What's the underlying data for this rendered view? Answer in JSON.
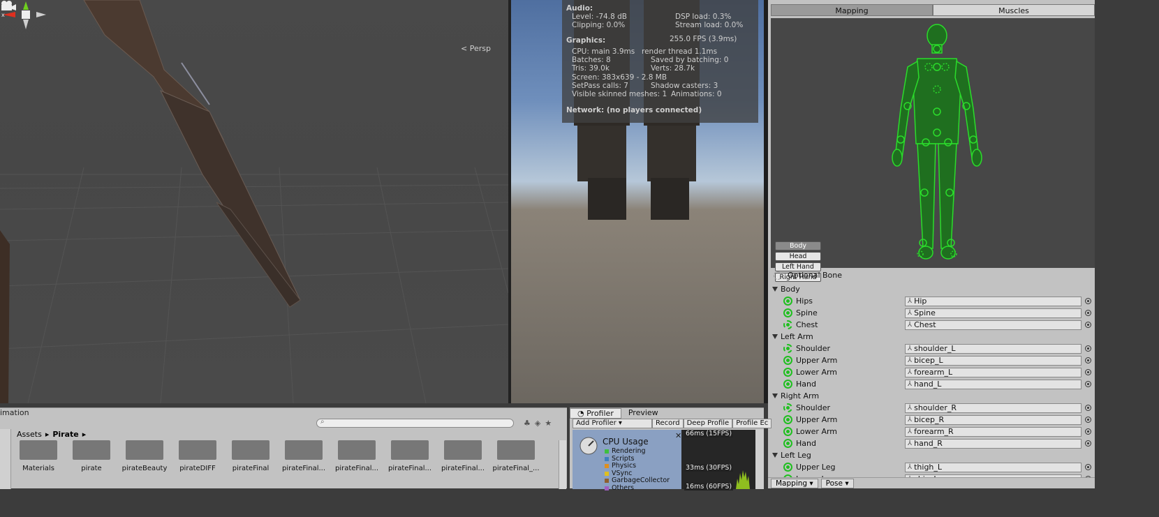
{
  "scene": {
    "persp_label": "Persp"
  },
  "stats": {
    "audio_header": "Audio:",
    "audio_rows": [
      [
        "Level: -74.8 dB",
        "DSP load: 0.3%"
      ],
      [
        "Clipping: 0.0%",
        "Stream load: 0.0%"
      ]
    ],
    "graphics_header": "Graphics:",
    "fps": "255.0 FPS (3.9ms)",
    "graphics_rows": [
      [
        "CPU: main 3.9ms",
        "render thread 1.1ms"
      ],
      [
        "Batches: 8",
        "Saved by batching: 0"
      ],
      [
        "Tris: 39.0k",
        "Verts: 28.7k"
      ],
      [
        "Screen: 383x639 - 2.8 MB",
        ""
      ],
      [
        "SetPass calls: 7",
        "Shadow casters: 3"
      ],
      [
        "Visible skinned meshes: 1",
        "Animations: 0"
      ]
    ],
    "network": "Network: (no players connected)"
  },
  "inspector": {
    "tabs": [
      "Mapping",
      "Muscles"
    ],
    "active_tab": "Mapping",
    "part_buttons": [
      "Body",
      "Head",
      "Left Hand",
      "Right Hand"
    ],
    "active_part": "Body",
    "optional_bone": "Optional Bone",
    "groups": [
      {
        "name": "Body",
        "bones": [
          {
            "name": "Hips",
            "value": "Hip",
            "optional": false
          },
          {
            "name": "Spine",
            "value": "Spine",
            "optional": false
          },
          {
            "name": "Chest",
            "value": "Chest",
            "optional": true
          }
        ]
      },
      {
        "name": "Left Arm",
        "bones": [
          {
            "name": "Shoulder",
            "value": "shoulder_L",
            "optional": true
          },
          {
            "name": "Upper Arm",
            "value": "bicep_L",
            "optional": false
          },
          {
            "name": "Lower Arm",
            "value": "forearm_L",
            "optional": false
          },
          {
            "name": "Hand",
            "value": "hand_L",
            "optional": false
          }
        ]
      },
      {
        "name": "Right Arm",
        "bones": [
          {
            "name": "Shoulder",
            "value": "shoulder_R",
            "optional": true
          },
          {
            "name": "Upper Arm",
            "value": "bicep_R",
            "optional": false
          },
          {
            "name": "Lower Arm",
            "value": "forearm_R",
            "optional": false
          },
          {
            "name": "Hand",
            "value": "hand_R",
            "optional": false
          }
        ]
      },
      {
        "name": "Left Leg",
        "bones": [
          {
            "name": "Upper Leg",
            "value": "thigh_L",
            "optional": false
          },
          {
            "name": "Lower Leg",
            "value": "shin_L",
            "optional": false
          }
        ]
      }
    ],
    "bottom": {
      "mapping": "Mapping",
      "pose": "Pose"
    }
  },
  "project": {
    "tab_label": "imation",
    "breadcrumb": [
      "Assets",
      "Pirate"
    ],
    "assets": [
      "Materials",
      "pirate",
      "pirateBeauty",
      "pirateDIFF",
      "pirateFinal",
      "pirateFinal...",
      "pirateFinal...",
      "pirateFinal...",
      "pirateFinal...",
      "pirateFinal_..."
    ]
  },
  "profiler": {
    "tabs": [
      "Profiler",
      "Preview"
    ],
    "add_profiler": "Add Profiler",
    "tools": [
      "Record",
      "Deep Profile",
      "Profile Ec"
    ],
    "cpu_title": "CPU Usage",
    "legend": [
      {
        "label": "Rendering",
        "color": "#3fbf3f"
      },
      {
        "label": "Scripts",
        "color": "#3f7fbf"
      },
      {
        "label": "Physics",
        "color": "#df8f1f"
      },
      {
        "label": "VSync",
        "color": "#dfbf1f"
      },
      {
        "label": "GarbageCollector",
        "color": "#8f5f2f"
      },
      {
        "label": "Others",
        "color": "#9f5fbf"
      }
    ],
    "graph_labels": [
      "66ms (15FPS)",
      "33ms (30FPS)",
      "16ms (60FPS)"
    ]
  }
}
